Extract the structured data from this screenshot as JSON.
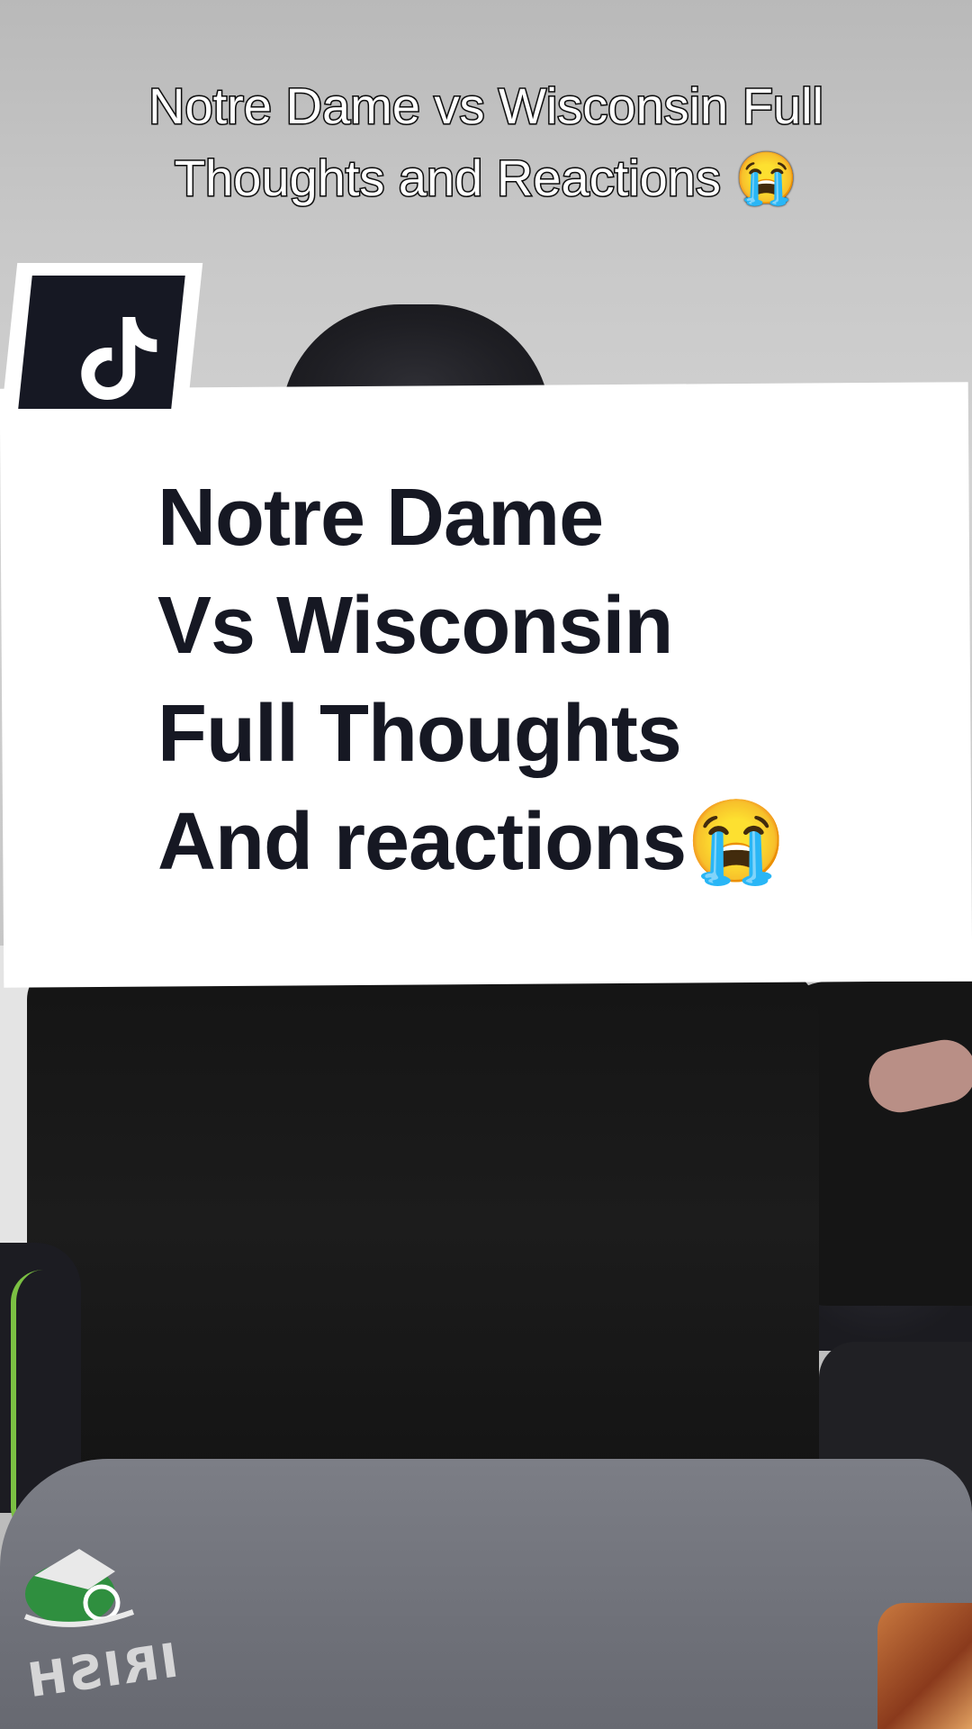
{
  "caption": {
    "line1": "Notre Dame vs Wisconsin Full",
    "line2": "Thoughts and Reactions 😭"
  },
  "card": {
    "lines": [
      "Notre Dame",
      "Vs Wisconsin",
      "Full Thoughts",
      "And reactions😭"
    ]
  },
  "badge": {
    "icon": "tiktok-logo-icon"
  },
  "colors": {
    "card_text": "#161823",
    "badge_bg": "#161823",
    "card_bg": "#ffffff"
  }
}
